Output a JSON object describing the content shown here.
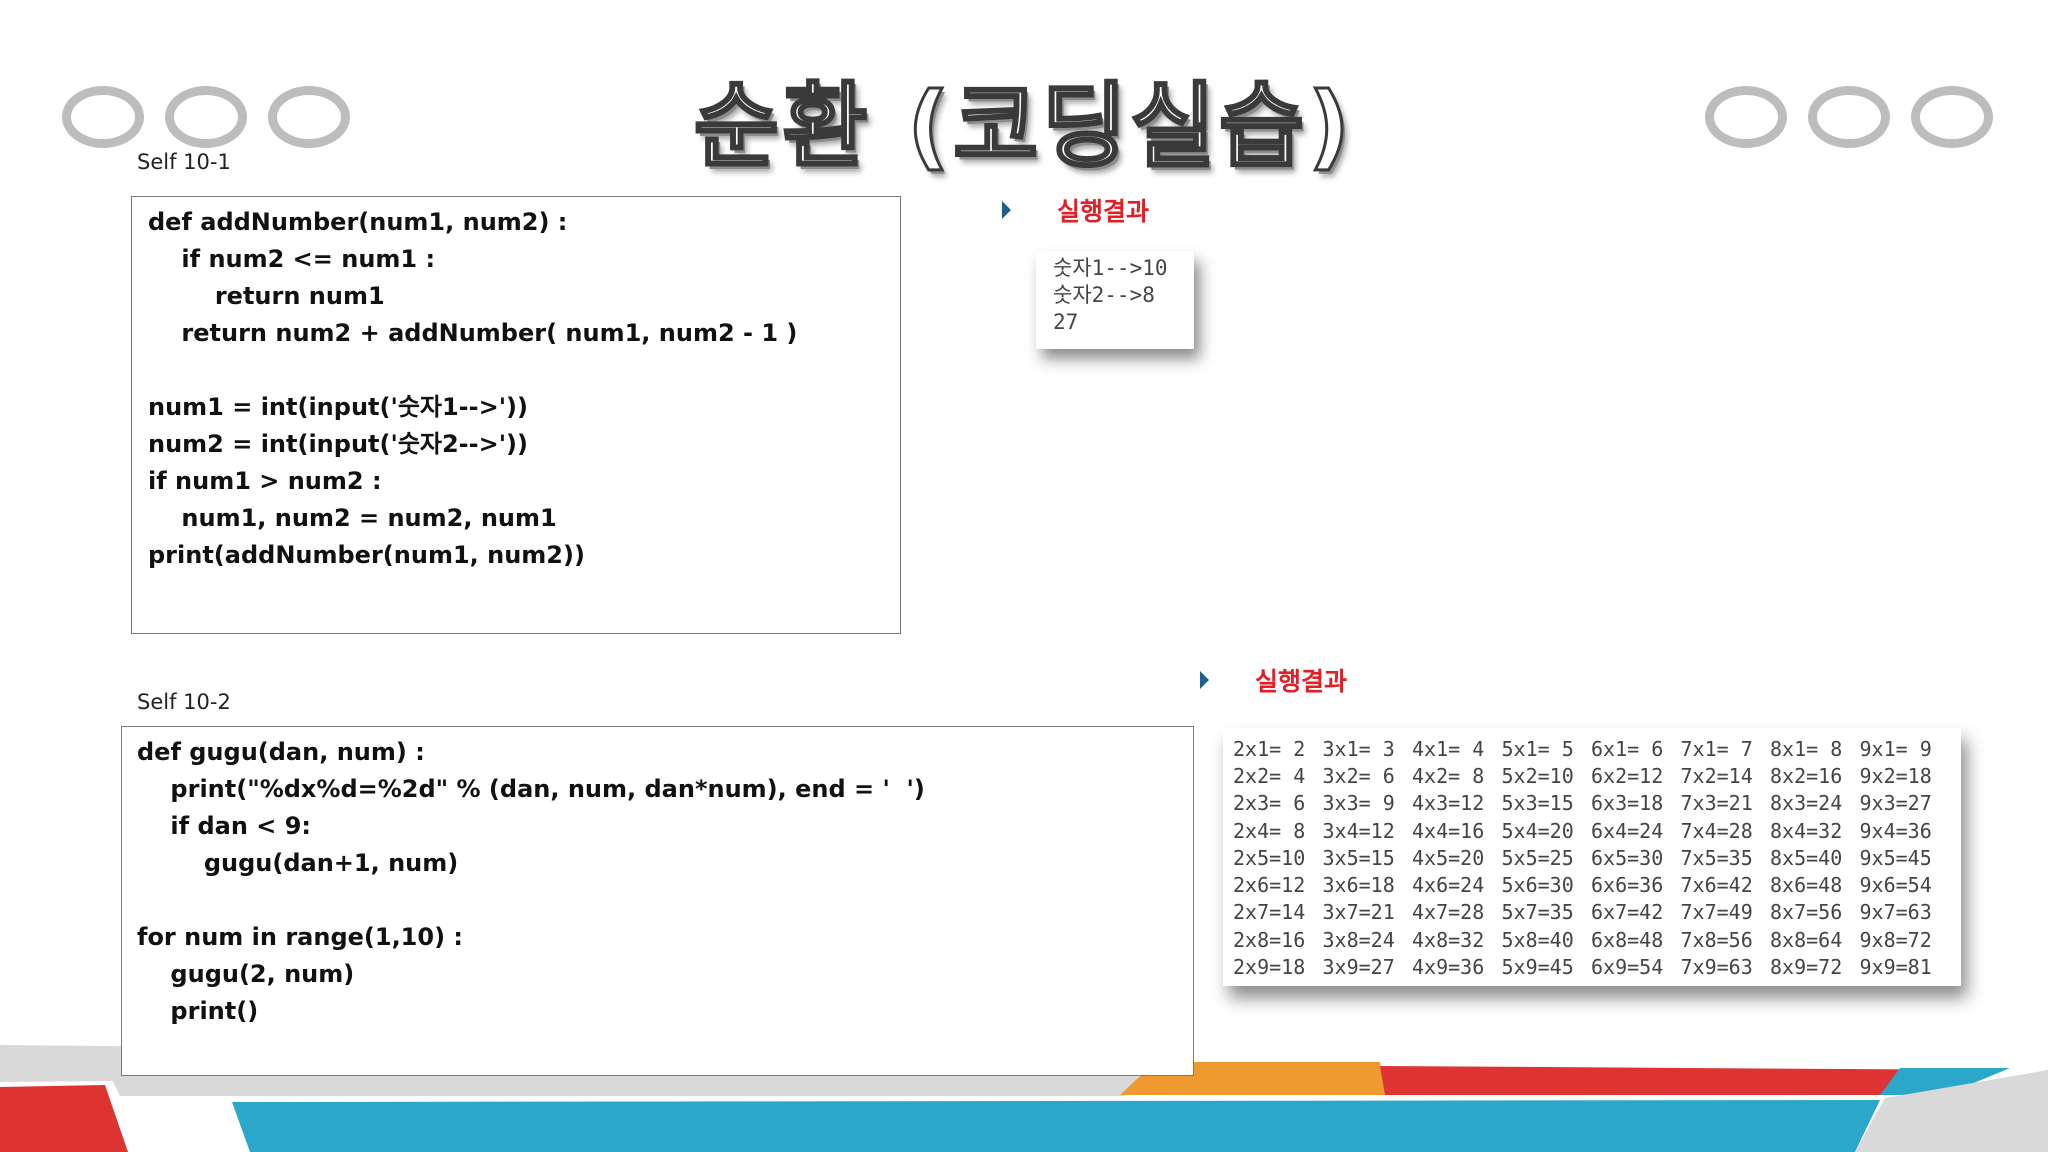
{
  "title": "순환 (코딩실습)",
  "self1": {
    "label": "Self 10-1",
    "code": [
      "def addNumber(num1, num2) :",
      "    if num2 <= num1 :",
      "        return num1",
      "    return num2 + addNumber( num1, num2 - 1 )",
      "",
      "num1 = int(input('숫자1-->'))",
      "num2 = int(input('숫자2-->'))",
      "if num1 > num2 :",
      "    num1, num2 = num2, num1",
      "print(addNumber(num1, num2))"
    ],
    "result_label": "실행결과",
    "output": [
      "숫자1-->10",
      "숫자2-->8",
      "27"
    ]
  },
  "self2": {
    "label": "Self 10-2",
    "code": [
      "def gugu(dan, num) :",
      "    print(\"%dx%d=%2d\" % (dan, num, dan*num), end = '  ')",
      "    if dan < 9:",
      "        gugu(dan+1, num)",
      "",
      "for num in range(1,10) :",
      "    gugu(2, num)",
      "    print()"
    ],
    "result_label": "실행결과",
    "output": [
      [
        "2x1= 2",
        "3x1= 3",
        "4x1= 4",
        "5x1= 5",
        "6x1= 6",
        "7x1= 7",
        "8x1= 8",
        "9x1= 9"
      ],
      [
        "2x2= 4",
        "3x2= 6",
        "4x2= 8",
        "5x2=10",
        "6x2=12",
        "7x2=14",
        "8x2=16",
        "9x2=18"
      ],
      [
        "2x3= 6",
        "3x3= 9",
        "4x3=12",
        "5x3=15",
        "6x3=18",
        "7x3=21",
        "8x3=24",
        "9x3=27"
      ],
      [
        "2x4= 8",
        "3x4=12",
        "4x4=16",
        "5x4=20",
        "6x4=24",
        "7x4=28",
        "8x4=32",
        "9x4=36"
      ],
      [
        "2x5=10",
        "3x5=15",
        "4x5=20",
        "5x5=25",
        "6x5=30",
        "7x5=35",
        "8x5=40",
        "9x5=45"
      ],
      [
        "2x6=12",
        "3x6=18",
        "4x6=24",
        "5x6=30",
        "6x6=36",
        "7x6=42",
        "8x6=48",
        "9x6=54"
      ],
      [
        "2x7=14",
        "3x7=21",
        "4x7=28",
        "5x7=35",
        "6x7=42",
        "7x7=49",
        "8x7=56",
        "9x7=63"
      ],
      [
        "2x8=16",
        "3x8=24",
        "4x8=32",
        "5x8=40",
        "6x8=48",
        "7x8=56",
        "8x8=64",
        "9x8=72"
      ],
      [
        "2x9=18",
        "3x9=27",
        "4x9=36",
        "5x9=45",
        "6x9=54",
        "7x9=63",
        "8x9=72",
        "9x9=81"
      ]
    ]
  },
  "colors": {
    "accent_red": "#e01f26",
    "deco_blue": "#2aa7c9",
    "deco_orange": "#ef9a2f",
    "deco_red": "#dd3333",
    "deco_gray": "#d9d9d9",
    "bullet": "#1f5e8c"
  },
  "icons": {
    "bullet": "triangle-bullet-icon",
    "ornament": "ring-ornament-icon"
  }
}
